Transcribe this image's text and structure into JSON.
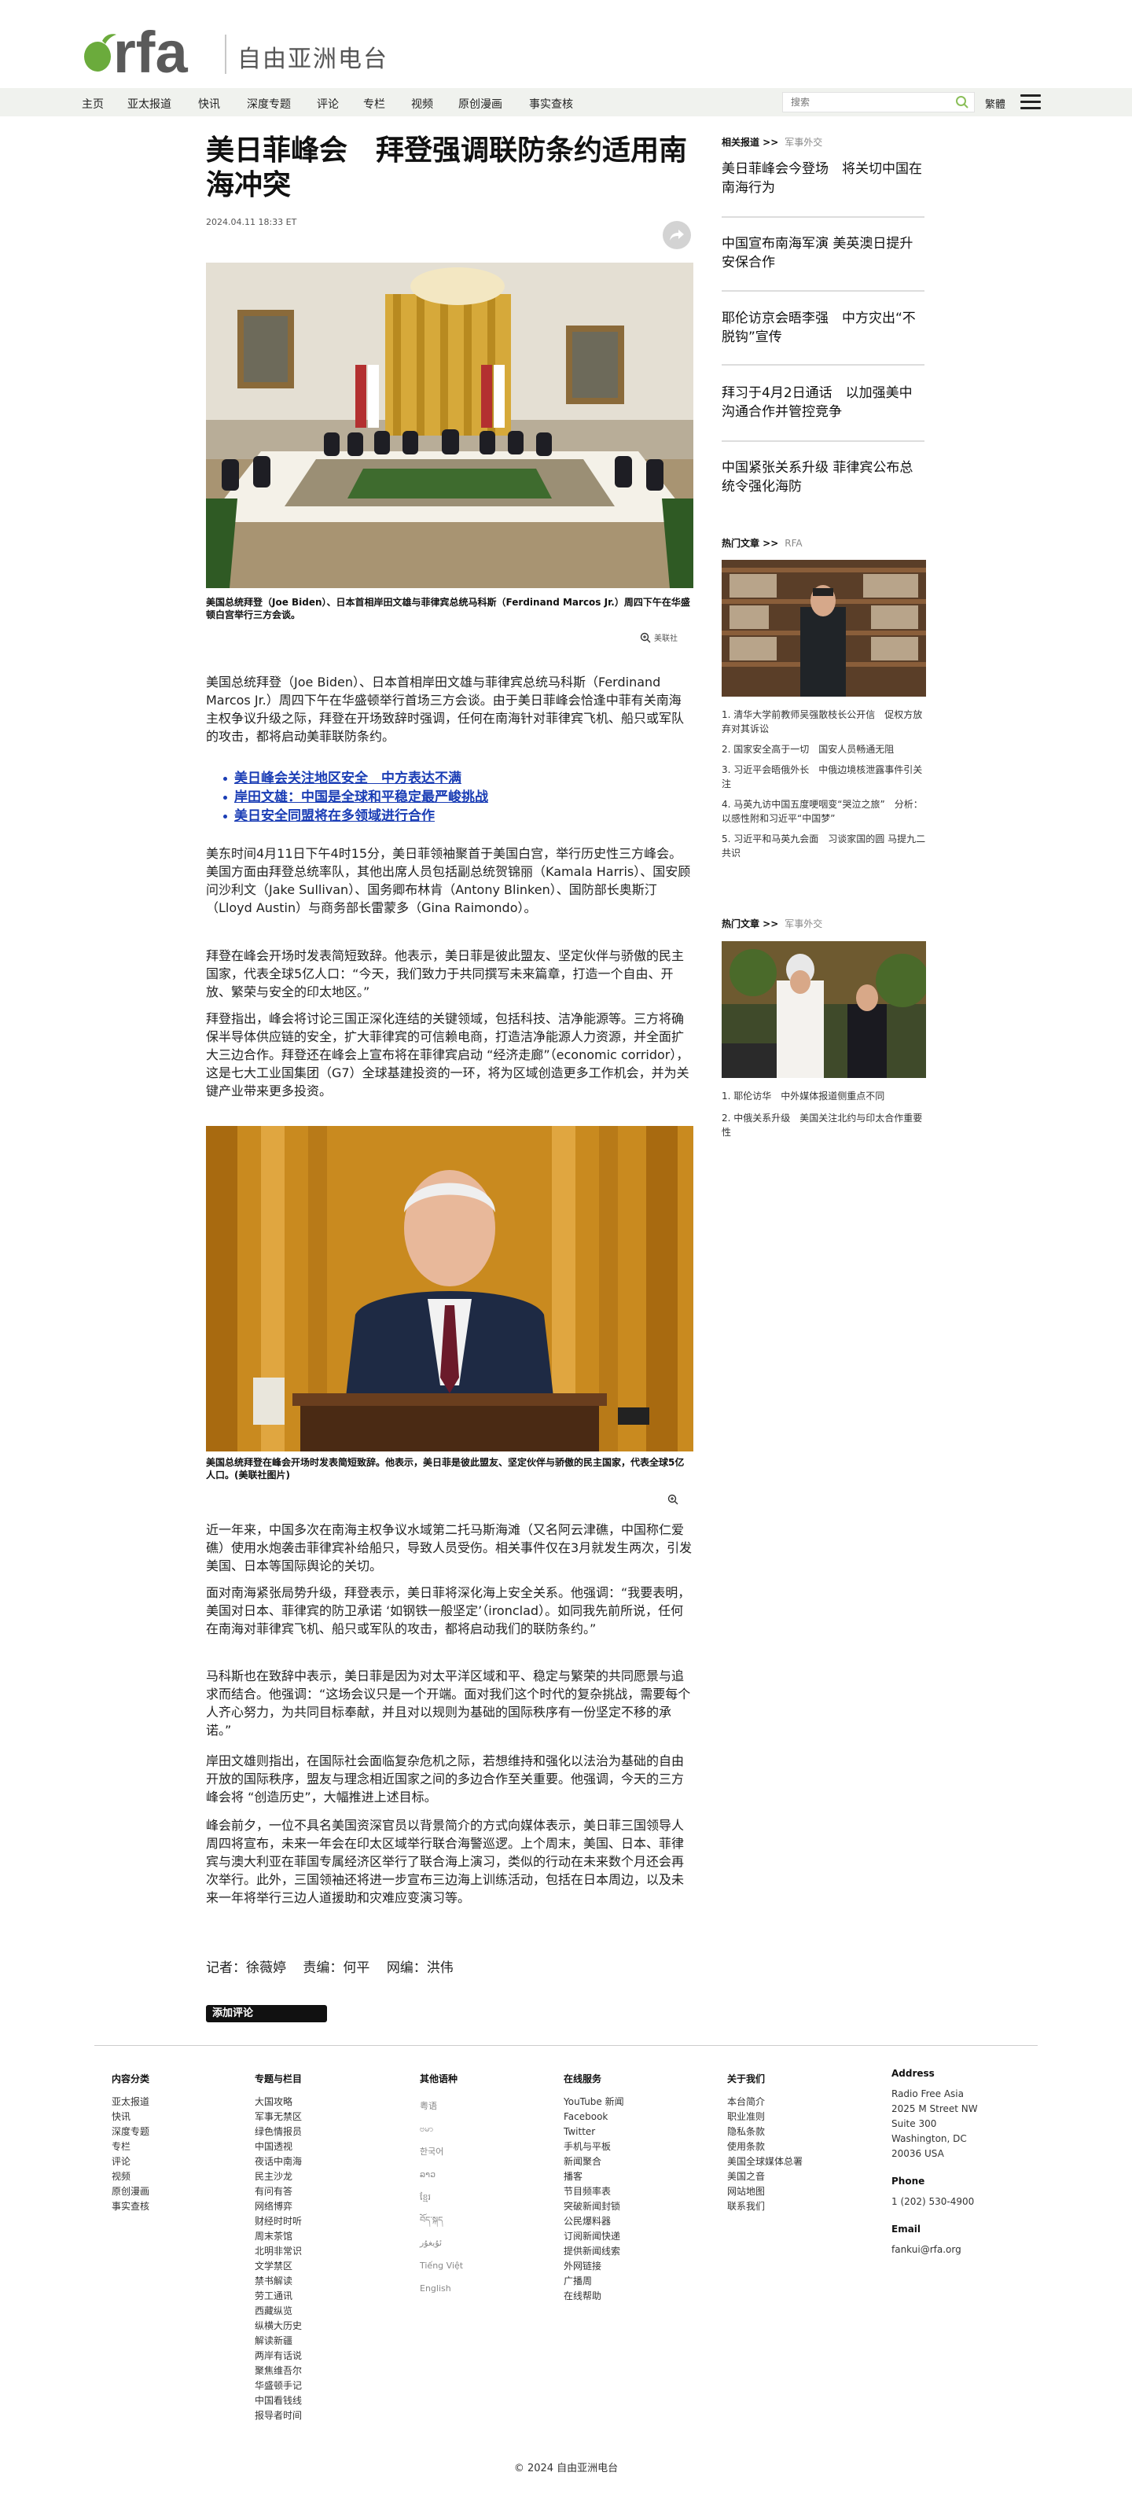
{
  "site": {
    "logo_text": "rfa",
    "name": "自由亚洲电台",
    "search_placeholder": "搜索",
    "lang_toggle": "繁體"
  },
  "nav": [
    "主页",
    "亚太报道",
    "快讯",
    "深度专题",
    "评论",
    "专栏",
    "视频",
    "原创漫画",
    "事实查核"
  ],
  "article": {
    "title": "美日菲峰会　拜登强调联防条约适用南海冲突",
    "date": "2024.04.11 18:33 ET",
    "photo1_caption": "美国总统拜登（Joe Biden）、日本首相岸田文雄与菲律宾总统马科斯（Ferdinand Marcos Jr.）周四下午在华盛顿白宫举行三方会谈。",
    "photo1_credit": "美联社",
    "intro": "美国总统拜登（Joe Biden）、日本首相岸田文雄与菲律宾总统马科斯（Ferdinand Marcos Jr.）周四下午在华盛顿举行首场三方会谈。由于美日菲峰会恰逢中菲有关南海主权争议升级之际，拜登在开场致辞时强调，任何在南海针对菲律宾飞机、船只或军队的攻击，都将启动美菲联防条约。",
    "related": [
      "美日峰会关注地区安全　中方表达不满",
      "岸田文雄：中国是全球和平稳定最严峻挑战",
      "美日安全同盟将在多领域进行合作"
    ],
    "p1": "美东时间4月11日下午4时15分，美日菲领袖聚首于美国白宫，举行历史性三方峰会。美国方面由拜登总统率队，其他出席人员包括副总统贺锦丽（Kamala Harris）、国安顾问沙利文（Jake Sullivan）、国务卿布林肯（Antony Blinken）、国防部长奥斯汀（Lloyd Austin）与商务部长雷蒙多（Gina Raimondo）。",
    "p2": "拜登在峰会开场时发表简短致辞。他表示，美日菲是彼此盟友、坚定伙伴与骄傲的民主国家，代表全球5亿人口：“今天，我们致力于共同撰写未来篇章，打造一个自由、开放、繁荣与安全的印太地区。”",
    "p3": "拜登指出，峰会将讨论三国正深化连结的关键领域，包括科技、洁净能源等。三方将确保半导体供应链的安全，扩大菲律宾的可信赖电商，打造洁净能源人力资源，并全面扩大三边合作。拜登还在峰会上宣布将在菲律宾启动 “经济走廊”（economic corridor），这是七大工业国集团（G7）全球基建投资的一环，将为区域创造更多工作机会，并为关键产业带来更多投资。",
    "photo2_caption": "美国总统拜登在峰会开场时发表简短致辞。他表示，美日菲是彼此盟友、坚定伙伴与骄傲的民主国家，代表全球5亿人口。(美联社图片)",
    "p4": "近一年来，中国多次在南海主权争议水域第二托马斯海滩（又名阿云津礁，中国称仁爱礁）使用水炮袭击菲律宾补给船只，导致人员受伤。相关事件仅在3月就发生两次，引发美国、日本等国际舆论的关切。",
    "p5": "面对南海紧张局势升级，拜登表示，美日菲将深化海上安全关系。他强调：“我要表明，美国对日本、菲律宾的防卫承诺 ‘如钢铁一般坚定’（ironclad）。如同我先前所说，任何在南海对菲律宾飞机、船只或军队的攻击，都将启动我们的联防条约。”",
    "p6": "马科斯也在致辞中表示，美日菲是因为对太平洋区域和平、稳定与繁荣的共同愿景与追求而结合。他强调：“这场会议只是一个开端。面对我们这个时代的复杂挑战，需要每个人齐心努力，为共同目标奉献，并且对以规则为基础的国际秩序有一份坚定不移的承诺。”",
    "p7": "岸田文雄则指出，在国际社会面临复杂危机之际，若想维持和强化以法治为基础的自由开放的国际秩序，盟友与理念相近国家之间的多边合作至关重要。他强调，今天的三方峰会将 “创造历史”，大幅推进上述目标。",
    "p8": "峰会前夕，一位不具名美国资深官员以背景简介的方式向媒体表示，美日菲三国领导人周四将宣布，未来一年会在印太区域举行联合海警巡逻。上个周末，美国、日本、菲律宾与澳大利亚在菲国专属经济区举行了联合海上演习，类似的行动在未来数个月还会再次举行。此外，三国领袖还将进一步宣布三边海上训练活动，包括在日本周边，以及未来一年将举行三边人道援助和灾难应变演习等。",
    "credits": [
      "记者：徐薇婷",
      "责编：何平",
      "网编：洪伟"
    ],
    "comment_button": "添加评论"
  },
  "sidebar": {
    "related_head": "相关报道 >>",
    "related_sub": "军事外交",
    "related": [
      "美日菲峰会今登场　将关切中国在南海行为",
      "中国宣布南海军演 美英澳日提升安保合作",
      "耶伦访京会晤李强　中方灾出“不脱钩”宣传",
      "拜习于4月2日通话　以加强美中沟通合作并管控竞争",
      "中国紧张关系升级 菲律宾公布总统令强化海防"
    ],
    "hot1_head": "热门文章 >>",
    "hot1_sub": "RFA",
    "hot1_list": [
      "1. 清华大学前教师吴强散枝长公开信　促权方放弃对其诉讼",
      "2. 国家安全高于一切　国安人员畅通无阻",
      "3. 习近平会晤俄外长　中俄边境核泄露事件引关注",
      "4. 马英九访中国五度哽咽变“哭泣之旅”　分析：以感性附和习近平“中国梦”",
      "5. 习近平和马英九会面　习谈家国的圆 马提九二共识"
    ],
    "hot2_head": "热门文章 >>",
    "hot2_sub": "军事外交",
    "hot2_list": [
      "1. 耶伦访华　中外媒体报道侧重点不同",
      "2. 中俄关系升级　美国关注北约与印太合作重要性"
    ]
  },
  "footer": {
    "col1_head": "内容分类",
    "col1": [
      "亚太报道",
      "快讯",
      "深度专题",
      "专栏",
      "评论",
      "视频",
      "原创漫画",
      "事实查核"
    ],
    "col2_head": "专题与栏目",
    "col2": [
      "大国攻略",
      "军事无禁区",
      "绿色情报员",
      "中国透视",
      "夜话中南海",
      "民主沙龙",
      "有问有答",
      "网络博弈",
      "财经时时听",
      "周末茶馆",
      "北明非常识",
      "文学禁区",
      "禁书解读",
      "劳工通讯",
      "西藏纵览",
      "纵横大历史",
      "解读新疆",
      "两岸有话说",
      "聚焦维吾尔",
      "华盛顿手记",
      "中国看钱线",
      "报导者时间"
    ],
    "col3_head": "其他语种",
    "col3": [
      "粤语",
      "ဗမာ",
      "한국어",
      "ລາວ",
      "ខ្មែរ",
      "བོད་སྐད",
      "ئۇيغۇر",
      "Tiếng Việt",
      "English"
    ],
    "col4_head": "在线服务",
    "col4": [
      "YouTube 新闻",
      "Facebook",
      "Twitter",
      "手机与平板",
      "新闻聚合",
      "播客",
      "节目频率表",
      "突破新闻封锁",
      "公民爆料器",
      "订阅新闻快递",
      "提供新闻线索",
      "外网链接",
      "广播周",
      "在线帮助"
    ],
    "col5_head": "关于我们",
    "col5": [
      "本台简介",
      "职业准则",
      "隐私条款",
      "使用条款",
      "美国全球媒体总署",
      "美国之音",
      "网站地图",
      "联系我们"
    ],
    "address_head": "Address",
    "address": [
      "Radio Free Asia",
      "2025 M Street NW",
      "Suite 300",
      "Washington, DC",
      "20036 USA"
    ],
    "phone_head": "Phone",
    "phone": "1 (202) 530-4900",
    "email_head": "Email",
    "email": "fankui@rfa.org",
    "copyright": "© 2024 自由亚洲电台"
  },
  "colors": {
    "brand_green": "#6bab3c",
    "nav_bg": "#f0f2ee",
    "link_blue": "#1a3db5"
  }
}
